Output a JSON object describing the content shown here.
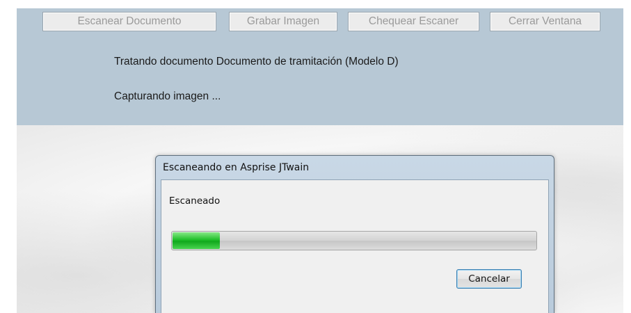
{
  "toolbar": {
    "scan_label": "Escanear Documento",
    "save_label": "Grabar Imagen",
    "check_label": "Chequear Escaner",
    "close_label": "Cerrar Ventana"
  },
  "status": {
    "line1": "Tratando documento Documento de tramitación (Modelo D)",
    "line2": "Capturando imagen ..."
  },
  "dialog": {
    "title": "Escaneando en Asprise JTwain",
    "message": "Escaneado",
    "progress_fraction": 0.13,
    "cancel_label": "Cancelar"
  }
}
